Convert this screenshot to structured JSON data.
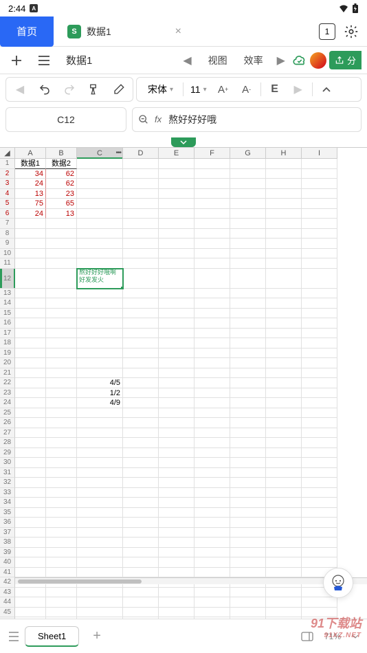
{
  "status": {
    "time": "2:44",
    "badge": "A",
    "windows": "1"
  },
  "tabs": {
    "home": "首页",
    "file_icon": "S",
    "file_name": "数据1"
  },
  "menu": {
    "file_name": "数据1",
    "view": "视图",
    "efficiency": "效率",
    "share": "分"
  },
  "toolbar": {
    "font": "宋体",
    "size": "11"
  },
  "formula": {
    "cell_ref": "C12",
    "content": "熬好好好哦"
  },
  "sheet": {
    "columns": [
      "A",
      "B",
      "C",
      "D",
      "E",
      "F",
      "G",
      "H",
      "I"
    ],
    "headers": {
      "A": "数据1",
      "B": "数据2"
    },
    "dataA": [
      "34",
      "24",
      "13",
      "75",
      "24"
    ],
    "dataB": [
      "62",
      "62",
      "23",
      "65",
      "13"
    ],
    "c12": "熬好好好哦啊好发发火",
    "c22": "4/5",
    "c23": "1/2",
    "c24": "4/9",
    "sel_col": "C",
    "sel_row": "12",
    "tab_name": "Sheet1",
    "zoom": "71%"
  },
  "watermark": {
    "main": "91下载站",
    "sub": "91XZ.NET"
  }
}
